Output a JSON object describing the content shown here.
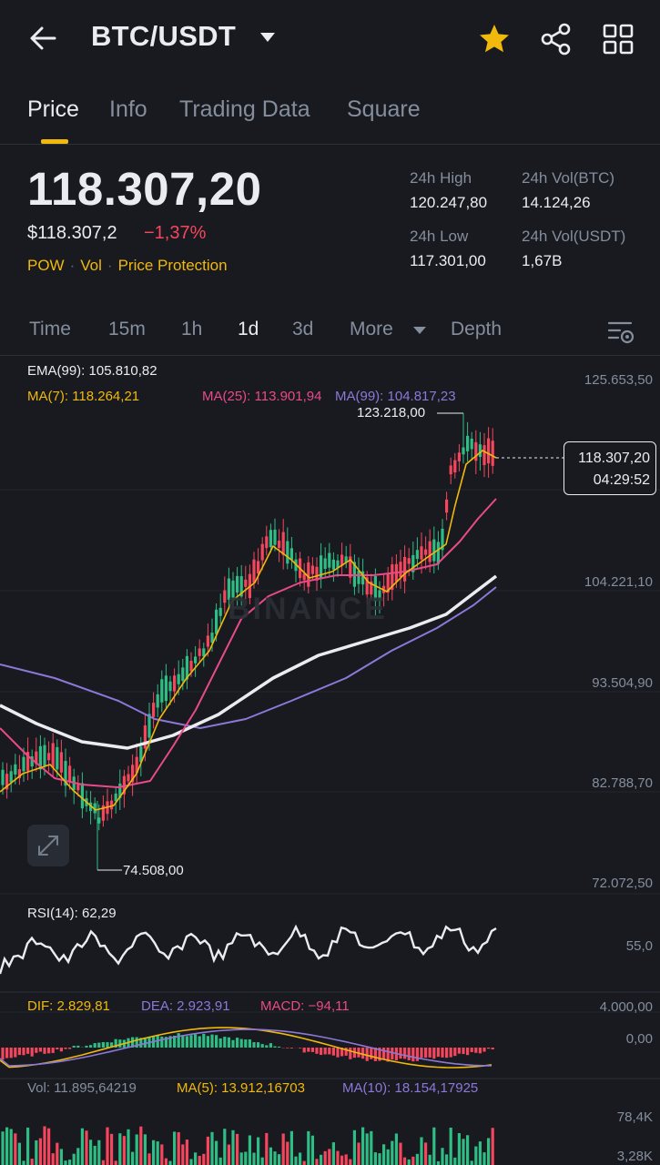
{
  "header": {
    "pair": "BTC/USDT",
    "icons": [
      "back-arrow-icon",
      "dropdown-caret-icon",
      "star-icon",
      "share-icon",
      "grid-icon"
    ],
    "star_color": "#f0b90b"
  },
  "tabs": [
    {
      "label": "Price",
      "active": true
    },
    {
      "label": "Info",
      "active": false
    },
    {
      "label": "Trading Data",
      "active": false
    },
    {
      "label": "Square",
      "active": false
    }
  ],
  "price": {
    "last": "118.307,20",
    "usd": "$118.307,2",
    "change": "−1,37%",
    "change_color": "#f6465d",
    "tags": [
      "POW",
      "Vol",
      "Price Protection"
    ]
  },
  "stats": {
    "high_label": "24h High",
    "high_value": "120.247,80",
    "low_label": "24h Low",
    "low_value": "117.301,00",
    "vol_btc_label": "24h Vol(BTC)",
    "vol_btc_value": "14.124,26",
    "vol_usdt_label": "24h Vol(USDT)",
    "vol_usdt_value": "1,67B"
  },
  "timeframes": [
    {
      "label": "Time",
      "active": false
    },
    {
      "label": "15m",
      "active": false
    },
    {
      "label": "1h",
      "active": false
    },
    {
      "label": "1d",
      "active": true
    },
    {
      "label": "3d",
      "active": false
    },
    {
      "label": "More",
      "active": false
    },
    {
      "label": "Depth",
      "active": false
    }
  ],
  "chart": {
    "ema_label": "EMA(99): 105.810,82",
    "ma7_label": "MA(7): 118.264,21",
    "ma25_label": "MA(25): 113.901,94",
    "ma99_label": "MA(99): 104.817,23",
    "high_marker": "123.218,00",
    "low_marker": "74.508,00",
    "current_price": "118.307,20",
    "countdown": "04:29:52",
    "watermark": "BINANCE",
    "price_axis": [
      "125.653,50",
      "104.221,10",
      "93.504,90",
      "82.788,70",
      "72.072,50"
    ],
    "colors": {
      "ma7": "#f0b90b",
      "ma25": "#e84a8a",
      "ma99": "#8d78d8",
      "ema": "#eaecef",
      "up": "#2ebd85",
      "down": "#f6465d"
    }
  },
  "rsi": {
    "label": "RSI(14): 62,29",
    "axis": "55,0"
  },
  "macd": {
    "dif": "DIF: 2.829,81",
    "dea": "DEA: 2.923,91",
    "macd": "MACD: −94,11",
    "axis_top": "4.000,00",
    "axis_zero": "0,00"
  },
  "volume": {
    "vol": "Vol: 11.895,64219",
    "ma5": "MA(5): 13.912,16703",
    "ma10": "MA(10): 18.154,17925",
    "axis_top": "78,4K",
    "axis_bottom": "3,28K"
  }
}
